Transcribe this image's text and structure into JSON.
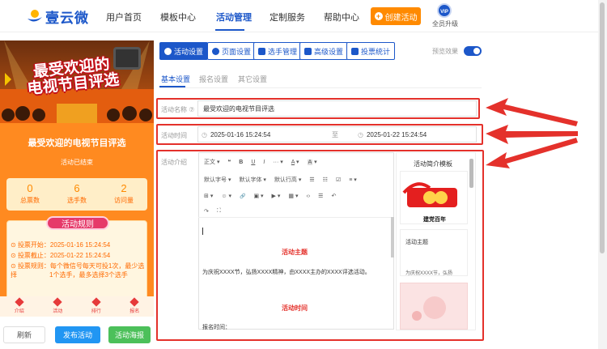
{
  "header": {
    "logo_text": "壹云微",
    "nav": [
      "用户首页",
      "模板中心",
      "活动管理",
      "定制服务",
      "帮助中心"
    ],
    "active_nav": "活动管理",
    "create_button": "创建活动",
    "vip_badge": "VIP",
    "vip_label": "全员升级"
  },
  "preview": {
    "banner_title_line1": "最受欢迎的",
    "banner_title_line2": "电视节目评选",
    "title": "最受欢迎的电视节目评选",
    "status": "活动已结束",
    "stats": [
      {
        "value": "0",
        "label": "总票数"
      },
      {
        "value": "6",
        "label": "选手数"
      },
      {
        "value": "2",
        "label": "访问量"
      }
    ],
    "rules_heading": "活动规则",
    "rules": [
      "投票开始：2025-01-16 15:24:54",
      "投票截止：2025-01-22 15:24:54",
      "投票规则：每个微信号每天可投1次，最少选择",
      "1个选手，最多选择3个选手"
    ],
    "bottom_nav": [
      "介绍",
      "活动",
      "排行",
      "报名"
    ],
    "buttons": {
      "refresh": "刷新",
      "publish": "发布活动",
      "poster": "活动海报"
    }
  },
  "toolbar": {
    "buttons": [
      "活动设置",
      "页面设置",
      "选手管理",
      "高级设置",
      "投票统计"
    ],
    "active": "活动设置",
    "preview_label": "预览效果",
    "preview_enabled": true
  },
  "subtabs": [
    "基本设置",
    "报名设置",
    "其它设置"
  ],
  "form": {
    "name_label": "活动名称",
    "name_value": "最受欢迎的电视节目评选",
    "time_label": "活动时间",
    "start_time": "2025-01-16 15:24:54",
    "to": "至",
    "end_time": "2025-01-22 15:24:54",
    "intro_label": "活动介绍"
  },
  "editor": {
    "row1": [
      "正文",
      "❝",
      "B",
      "U",
      "I",
      "···",
      "A",
      "A"
    ],
    "row2": [
      "默认字号",
      "默认字体",
      "默认行高",
      "☰",
      "☷",
      "☑",
      "≡"
    ],
    "row3": [
      "⊞",
      "☺",
      "🔗",
      "▣",
      "▶",
      "▦",
      "‹›",
      "☰",
      "↶"
    ],
    "row4": [
      "↷",
      "⛶"
    ],
    "section1": "活动主题",
    "para1": "为庆祝XXXX节，弘扬XXXX精神，由XXXX主办的XXXX评选活动。",
    "section2": "活动时间",
    "para2": "报名时间："
  },
  "templates": {
    "title": "活动简介模板",
    "card1_caption": "建党百年",
    "card2_title": "活动主题",
    "card2_text": "为庆祝XXXX节，弘扬"
  },
  "colors": {
    "accent": "#1c57c9",
    "highlight": "#e4312b",
    "orange": "#ff8a00"
  }
}
